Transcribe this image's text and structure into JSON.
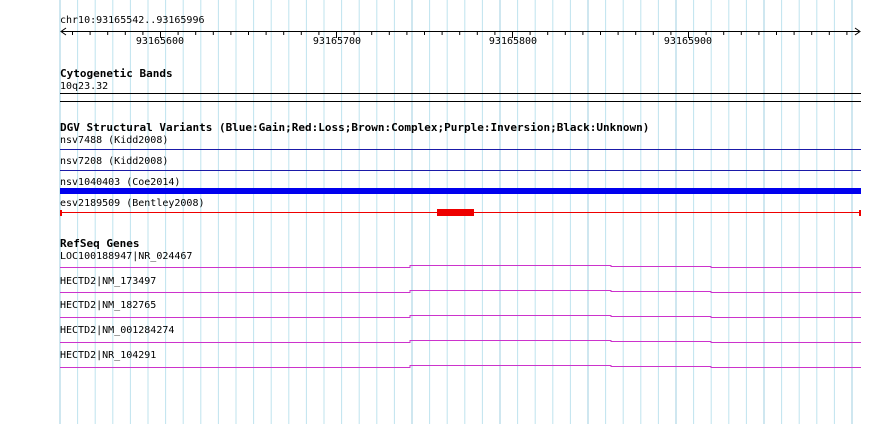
{
  "ruler": {
    "region": "chr10:93165542..93165996",
    "ticks": [
      "93165600",
      "93165700",
      "93165800",
      "93165900"
    ]
  },
  "cyto": {
    "title": "Cytogenetic Bands",
    "band": "10q23.32"
  },
  "dgv": {
    "title": "DGV Structural Variants (Blue:Gain;Red:Loss;Brown:Complex;Purple:Inversion;Black:Unknown)",
    "tracks": [
      {
        "label": "nsv7488 (Kidd2008)",
        "color": "#1a1aa8"
      },
      {
        "label": "nsv7208 (Kidd2008)",
        "color": "#1a1aa8"
      },
      {
        "label": "nsv1040403 (Coe2014)",
        "color": "#0000ee"
      },
      {
        "label": "esv2189509 (Bentley2008)",
        "color": "#ee0000"
      }
    ]
  },
  "refseq": {
    "title": "RefSeq Genes",
    "color": "#cc33cc",
    "genes": [
      "LOC100188947|NR_024467",
      "HECTD2|NM_173497",
      "HECTD2|NM_182765",
      "HECTD2|NM_001284274",
      "HECTD2|NR_104291"
    ]
  }
}
